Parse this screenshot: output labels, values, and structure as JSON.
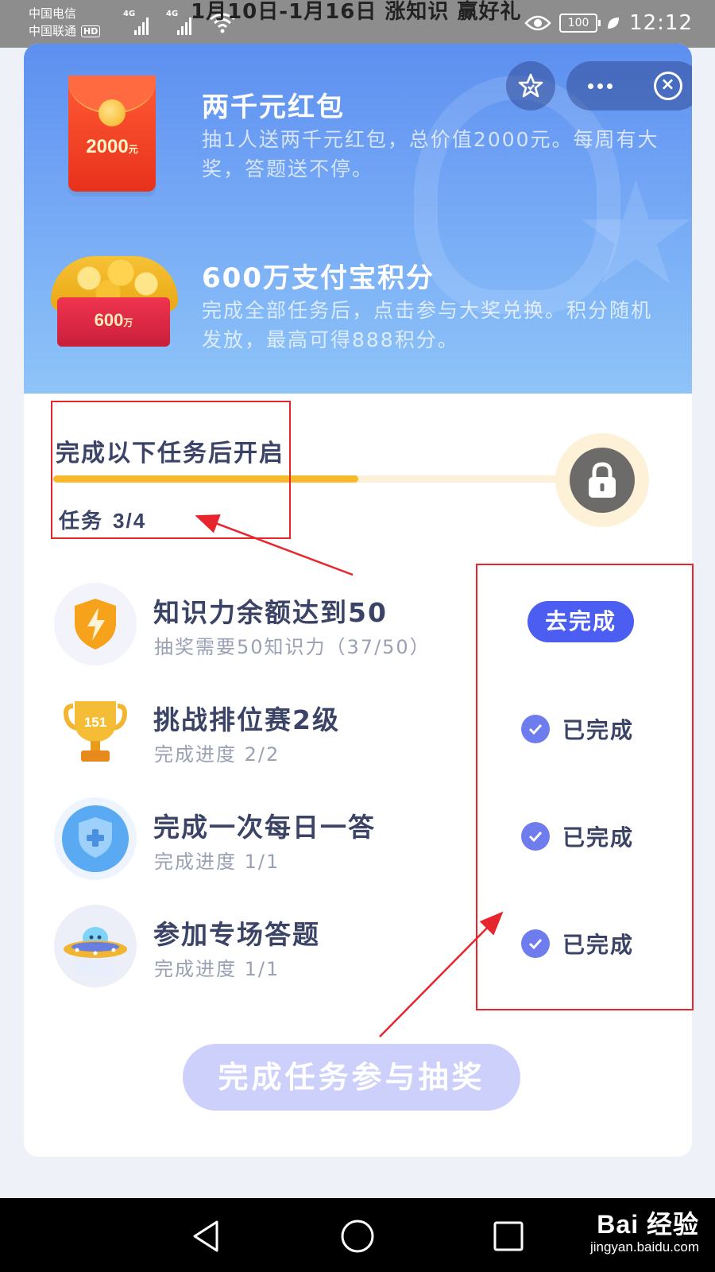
{
  "status_bar": {
    "carrier_1": "中国电信",
    "carrier_2": "中国联通",
    "hd_badge": "HD",
    "network_1": "4G",
    "network_2": "4G",
    "banner_text": "1月10日-1月16日 涨知识 赢好礼",
    "battery": "100",
    "time": "12:12"
  },
  "prizes": [
    {
      "title": "两千元红包",
      "description": "抽1人送两千元红包，总价值2000元。每周有大奖，答题送不停。",
      "badge": "2000",
      "badge_unit": "元"
    },
    {
      "title": "600万支付宝积分",
      "description": "完成全部任务后，点击参与大奖兑换。积分随机发放，最高可得888积分。",
      "badge": "600",
      "badge_unit": "万"
    }
  ],
  "progress": {
    "title": "完成以下任务后开启",
    "label": "任务",
    "count": "3/4",
    "completed": 3,
    "total": 4
  },
  "tasks": [
    {
      "title": "知识力余额达到50",
      "subtitle": "抽奖需要50知识力（37/50）",
      "status": "todo",
      "action_label": "去完成",
      "icon": "lightning-shield-icon"
    },
    {
      "title": "挑战排位赛2级",
      "subtitle": "完成进度 2/2",
      "status": "done",
      "action_label": "已完成",
      "icon": "trophy-icon",
      "icon_text": "151"
    },
    {
      "title": "完成一次每日一答",
      "subtitle": "完成进度 1/1",
      "status": "done",
      "action_label": "已完成",
      "icon": "plus-shield-icon"
    },
    {
      "title": "参加专场答题",
      "subtitle": "完成进度 1/1",
      "status": "done",
      "action_label": "已完成",
      "icon": "ufo-icon"
    }
  ],
  "cta": {
    "label": "完成任务参与抽奖"
  },
  "watermark": {
    "logo": "Bai 经验",
    "url": "jingyan.baidu.com"
  },
  "colors": {
    "header_blue": "#5d8ff0",
    "accent": "#4c5df2",
    "progress": "#f7b92a",
    "annotation_red": "#e6262c"
  }
}
